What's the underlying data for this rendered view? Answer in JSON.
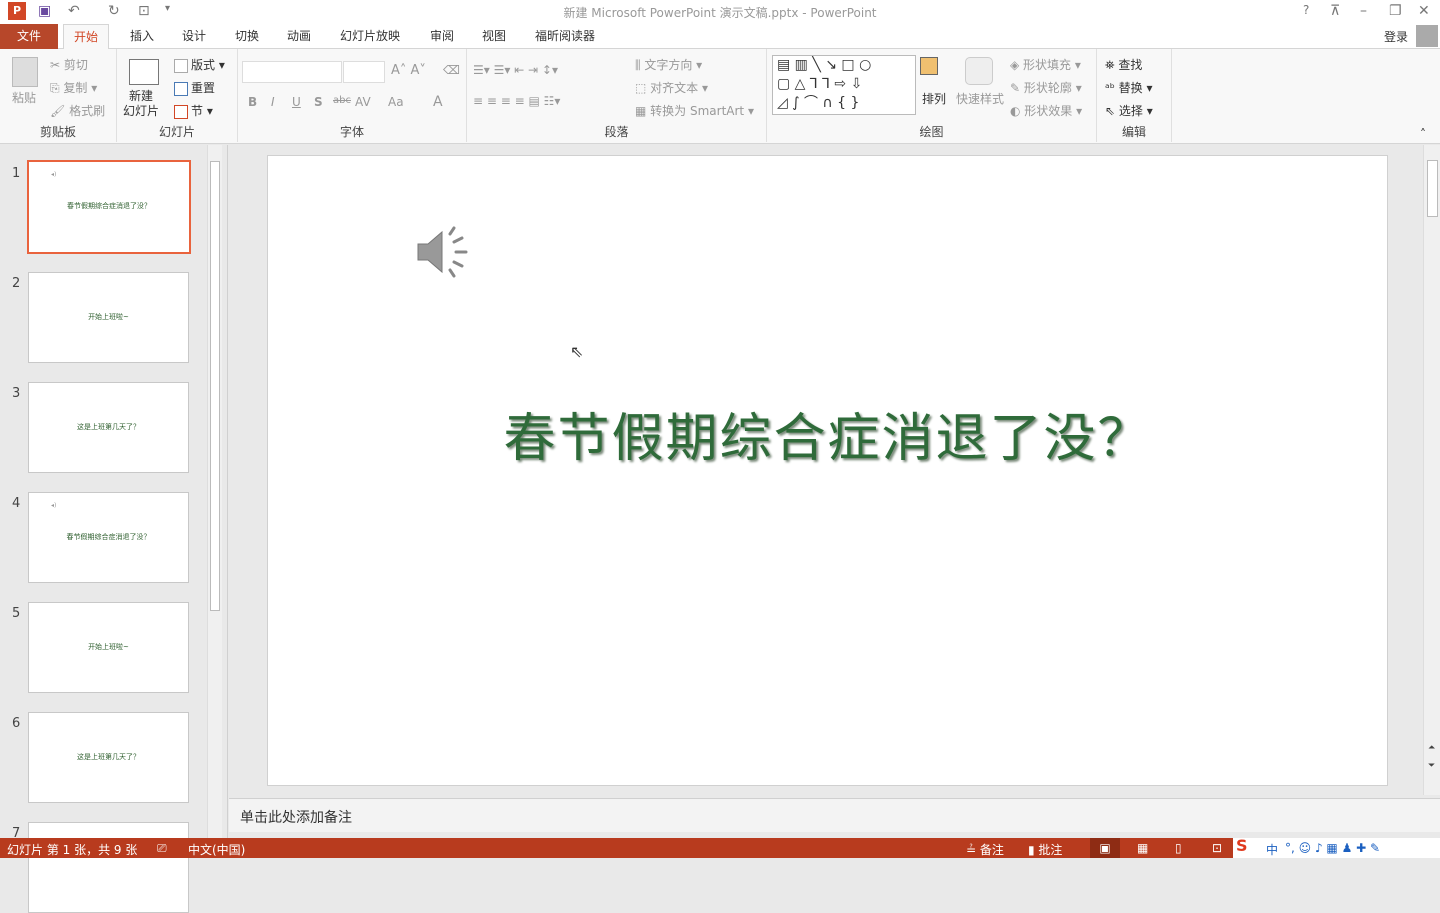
{
  "window": {
    "title": "新建 Microsoft PowerPoint 演示文稿.pptx - PowerPoint",
    "help": "?",
    "signin": "登录"
  },
  "tabs": [
    {
      "label": "文件"
    },
    {
      "label": "开始"
    },
    {
      "label": "插入"
    },
    {
      "label": "设计"
    },
    {
      "label": "切换"
    },
    {
      "label": "动画"
    },
    {
      "label": "幻灯片放映"
    },
    {
      "label": "审阅"
    },
    {
      "label": "视图"
    },
    {
      "label": "福昕阅读器"
    }
  ],
  "ribbon": {
    "clipboard": {
      "label": "剪贴板",
      "paste": "粘贴",
      "cut": "剪切",
      "copy": "复制",
      "format_painter": "格式刷"
    },
    "slides": {
      "label": "幻灯片",
      "new_slide": "新建\n幻灯片",
      "layout": "版式",
      "reset": "重置",
      "section": "节"
    },
    "font": {
      "label": "字体",
      "bold": "B",
      "italic": "I",
      "underline": "U",
      "shadow": "S",
      "strike": "abc",
      "spacing": "AV",
      "case": "Aa",
      "color": "A"
    },
    "paragraph": {
      "label": "段落",
      "text_direction": "文字方向",
      "align_text": "对齐文本",
      "smartart": "转换为 SmartArt"
    },
    "drawing": {
      "label": "绘图",
      "arrange": "排列",
      "quick_styles": "快速样式",
      "fill": "形状填充",
      "outline": "形状轮廓",
      "effects": "形状效果"
    },
    "editing": {
      "label": "编辑",
      "find": "查找",
      "replace": "替换",
      "select": "选择"
    }
  },
  "slides": [
    {
      "number": "1",
      "text": "春节假期综合症消退了没？",
      "audio": true
    },
    {
      "number": "2",
      "text": "开始上班啦~"
    },
    {
      "number": "3",
      "text": "这是上班第几天了？"
    },
    {
      "number": "4",
      "text": "春节假期综合症消退了没？",
      "audio": true
    },
    {
      "number": "5",
      "text": "开始上班啦~"
    },
    {
      "number": "6",
      "text": "这是上班第几天了？"
    },
    {
      "number": "7",
      "text": ""
    }
  ],
  "main_slide": {
    "title": "春节假期综合症消退了没？"
  },
  "notes": {
    "placeholder": "单击此处添加备注"
  },
  "status": {
    "slide_info": "幻灯片 第 1 张，共 9 张",
    "language": "中文(中国)",
    "notes": "备注",
    "comments": "批注",
    "ime": "中"
  },
  "colors": {
    "accent": "#b7472a",
    "status": "#b83b1e",
    "selection": "#e9633d",
    "title_text": "#2f6b3a"
  }
}
